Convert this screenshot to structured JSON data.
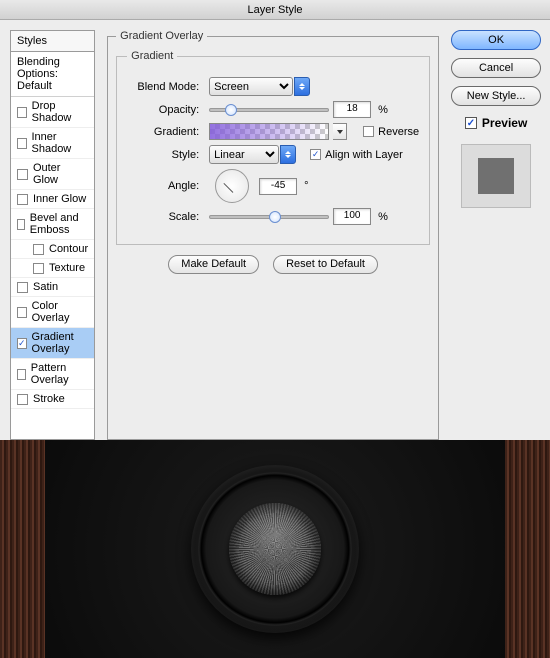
{
  "title": "Layer Style",
  "left": {
    "header": "Styles",
    "blending": "Blending Options: Default",
    "items": [
      {
        "label": "Drop Shadow",
        "checked": false,
        "indent": false,
        "selected": false
      },
      {
        "label": "Inner Shadow",
        "checked": false,
        "indent": false,
        "selected": false
      },
      {
        "label": "Outer Glow",
        "checked": false,
        "indent": false,
        "selected": false
      },
      {
        "label": "Inner Glow",
        "checked": false,
        "indent": false,
        "selected": false
      },
      {
        "label": "Bevel and Emboss",
        "checked": false,
        "indent": false,
        "selected": false
      },
      {
        "label": "Contour",
        "checked": false,
        "indent": true,
        "selected": false
      },
      {
        "label": "Texture",
        "checked": false,
        "indent": true,
        "selected": false
      },
      {
        "label": "Satin",
        "checked": false,
        "indent": false,
        "selected": false
      },
      {
        "label": "Color Overlay",
        "checked": false,
        "indent": false,
        "selected": false
      },
      {
        "label": "Gradient Overlay",
        "checked": true,
        "indent": false,
        "selected": true
      },
      {
        "label": "Pattern Overlay",
        "checked": false,
        "indent": false,
        "selected": false
      },
      {
        "label": "Stroke",
        "checked": false,
        "indent": false,
        "selected": false
      }
    ]
  },
  "mid": {
    "legend_outer": "Gradient Overlay",
    "legend_inner": "Gradient",
    "blend_mode_label": "Blend Mode:",
    "blend_mode_value": "Screen",
    "opacity_label": "Opacity:",
    "opacity_value": "18",
    "opacity_pct_pos": 18,
    "gradient_label": "Gradient:",
    "reverse_label": "Reverse",
    "reverse_checked": false,
    "style_label": "Style:",
    "style_value": "Linear",
    "align_label": "Align with Layer",
    "align_checked": true,
    "angle_label": "Angle:",
    "angle_value": "-45",
    "angle_deg": "°",
    "scale_label": "Scale:",
    "scale_value": "100",
    "scale_pct_pos": 55,
    "pct": "%",
    "make_default": "Make Default",
    "reset_default": "Reset to Default"
  },
  "right": {
    "ok": "OK",
    "cancel": "Cancel",
    "new_style": "New Style...",
    "preview": "Preview",
    "preview_checked": true
  }
}
